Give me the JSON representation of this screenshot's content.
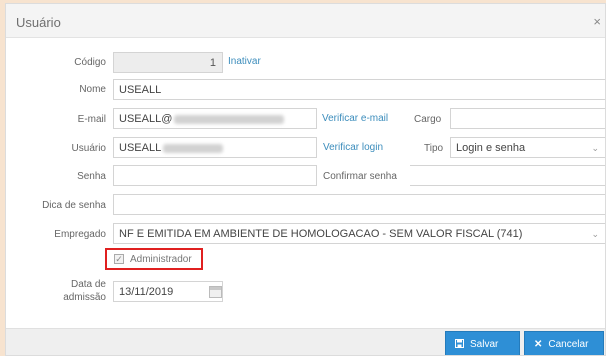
{
  "dialog": {
    "title": "Usuário",
    "close_glyph": "×"
  },
  "form": {
    "codigo": {
      "label": "Código",
      "value": "1",
      "link": "Inativar"
    },
    "nome": {
      "label": "Nome",
      "value": "USEALL"
    },
    "email": {
      "label": "E-mail",
      "value": "USEALL@",
      "link": "Verificar e-mail"
    },
    "cargo": {
      "label": "Cargo",
      "value": ""
    },
    "usuario": {
      "label": "Usuário",
      "value": "USEALL",
      "link": "Verificar login"
    },
    "tipo": {
      "label": "Tipo",
      "value": "Login e senha"
    },
    "senha": {
      "label": "Senha",
      "value": ""
    },
    "confirmar_senha": {
      "label": "Confirmar senha"
    },
    "dica_senha": {
      "label": "Dica de senha",
      "value": ""
    },
    "empregado": {
      "label": "Empregado",
      "value": "NF E EMITIDA EM AMBIENTE DE HOMOLOGACAO - SEM VALOR FISCAL (741)"
    },
    "administrador": {
      "label": "Administrador",
      "checked": true,
      "check_glyph": "✓"
    },
    "data_admissao": {
      "label_line1": "Data de",
      "label_line2": "admissão",
      "value": "13/11/2019"
    }
  },
  "footer": {
    "save": {
      "label": "Salvar",
      "icon": "save-icon"
    },
    "cancel": {
      "label": "Cancelar",
      "icon": "close-icon",
      "glyph": "✕"
    }
  },
  "colors": {
    "primary": "#2e8fd6",
    "link": "#3c8dbc",
    "highlight": "#e02020"
  }
}
